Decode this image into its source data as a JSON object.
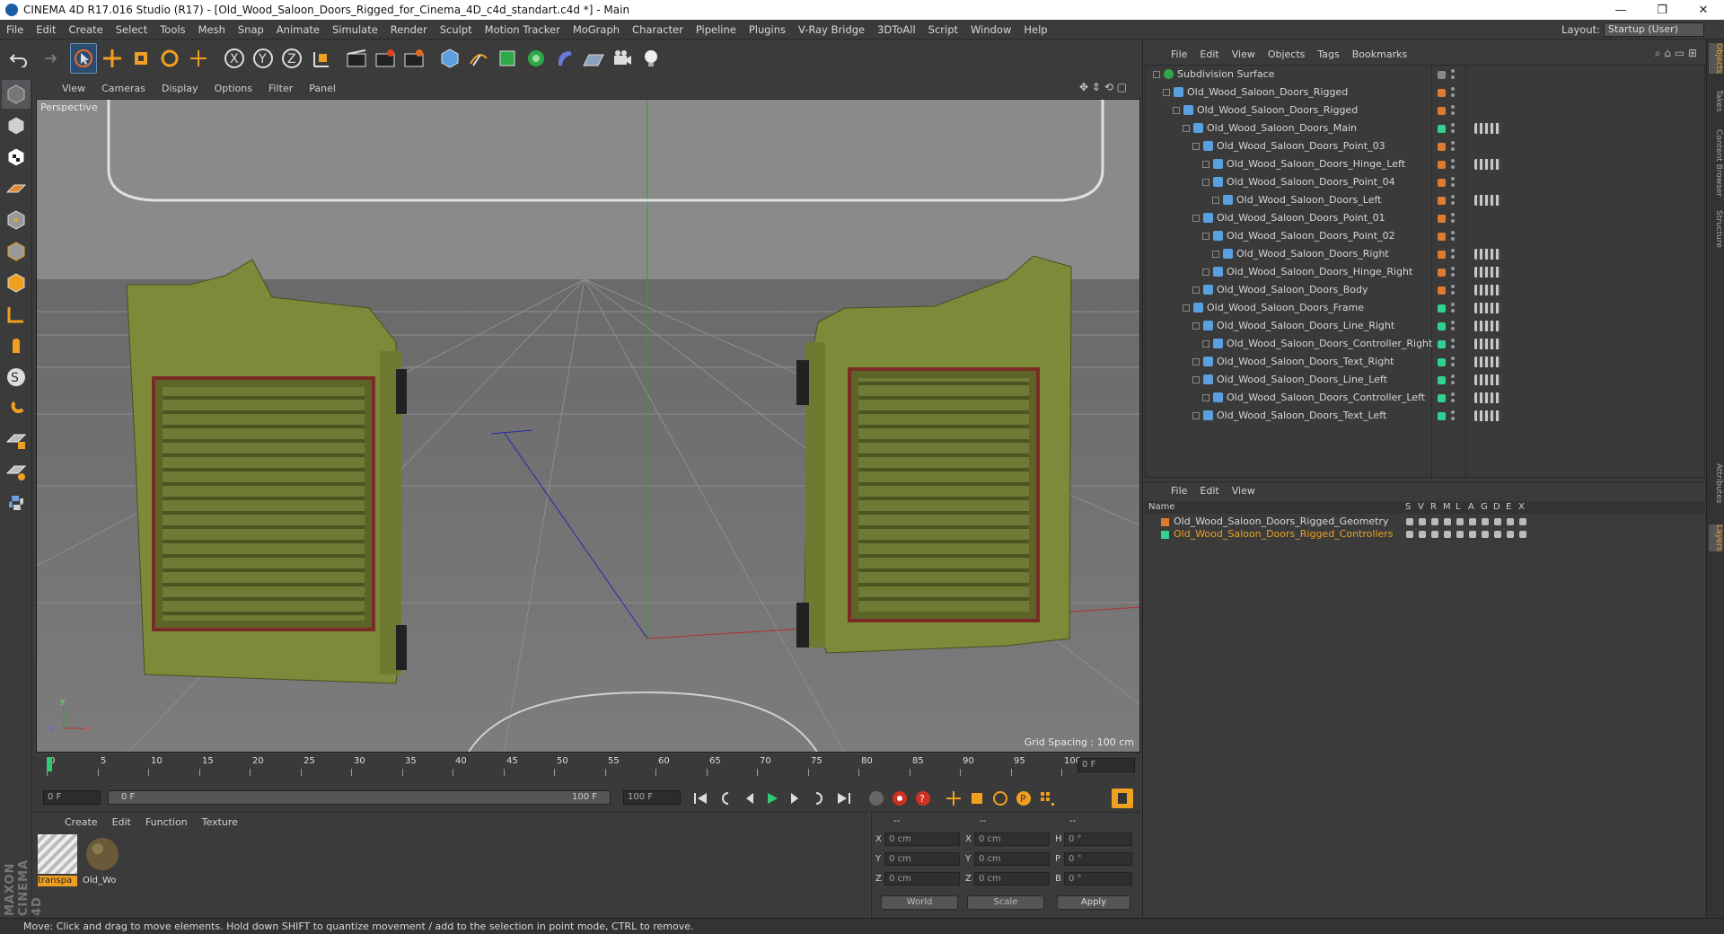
{
  "window": {
    "title": "CINEMA 4D R17.016 Studio (R17) - [Old_Wood_Saloon_Doors_Rigged_for_Cinema_4D_c4d_standart.c4d *] - Main",
    "controls": [
      "—",
      "❐",
      "✕"
    ]
  },
  "menubar": {
    "items": [
      "File",
      "Edit",
      "Create",
      "Select",
      "Tools",
      "Mesh",
      "Snap",
      "Animate",
      "Simulate",
      "Render",
      "Sculpt",
      "Motion Tracker",
      "MoGraph",
      "Character",
      "Pipeline",
      "Plugins",
      "V-Ray Bridge",
      "3DToAll",
      "Script",
      "Window",
      "Help"
    ],
    "layout_label": "Layout:",
    "layout_value": "Startup (User)"
  },
  "viewport": {
    "menu": [
      "View",
      "Cameras",
      "Display",
      "Options",
      "Filter",
      "Panel"
    ],
    "label": "Perspective",
    "grid_spacing": "Grid Spacing : 100 cm"
  },
  "timeline": {
    "ticks": [
      "0",
      "5",
      "10",
      "15",
      "20",
      "25",
      "30",
      "35",
      "40",
      "45",
      "50",
      "55",
      "60",
      "65",
      "70",
      "75",
      "80",
      "85",
      "90",
      "95",
      "100"
    ],
    "frame_field": "0 F",
    "start_field": "0 F",
    "range_start": "0 F",
    "range_end": "100 F",
    "end_field": "100 F"
  },
  "materials": {
    "menu": [
      "Create",
      "Edit",
      "Function",
      "Texture"
    ],
    "items": [
      {
        "label": "transpa",
        "selected": true
      },
      {
        "label": "Old_Wo",
        "selected": false
      }
    ]
  },
  "coords": {
    "headers": [
      "--",
      "--",
      "--"
    ],
    "rows": [
      {
        "a": "X",
        "av": "0 cm",
        "b": "X",
        "bv": "0 cm",
        "c": "H",
        "cv": "0 °"
      },
      {
        "a": "Y",
        "av": "0 cm",
        "b": "Y",
        "bv": "0 cm",
        "c": "P",
        "cv": "0 °"
      },
      {
        "a": "Z",
        "av": "0 cm",
        "b": "Z",
        "bv": "0 cm",
        "c": "B",
        "cv": "0 °"
      }
    ],
    "world": "World",
    "scale": "Scale",
    "apply": "Apply"
  },
  "status": "Move: Click and drag to move elements. Hold down SHIFT to quantize movement / add to the selection in point mode, CTRL to remove.",
  "objects": {
    "menu": [
      "File",
      "Edit",
      "View",
      "Objects",
      "Tags",
      "Bookmarks"
    ],
    "tree": [
      {
        "name": "Subdivision Surface",
        "depth": 0,
        "color": "#888888"
      },
      {
        "name": "Old_Wood_Saloon_Doors_Rigged",
        "depth": 1,
        "color": "#e07a2e"
      },
      {
        "name": "Old_Wood_Saloon_Doors_Rigged",
        "depth": 2,
        "color": "#e07a2e"
      },
      {
        "name": "Old_Wood_Saloon_Doors_Main",
        "depth": 3,
        "color": "#2fd28f"
      },
      {
        "name": "Old_Wood_Saloon_Doors_Point_03",
        "depth": 4,
        "color": "#e07a2e"
      },
      {
        "name": "Old_Wood_Saloon_Doors_Hinge_Left",
        "depth": 5,
        "color": "#e07a2e"
      },
      {
        "name": "Old_Wood_Saloon_Doors_Point_04",
        "depth": 5,
        "color": "#e07a2e"
      },
      {
        "name": "Old_Wood_Saloon_Doors_Left",
        "depth": 6,
        "color": "#e07a2e"
      },
      {
        "name": "Old_Wood_Saloon_Doors_Point_01",
        "depth": 4,
        "color": "#e07a2e"
      },
      {
        "name": "Old_Wood_Saloon_Doors_Point_02",
        "depth": 5,
        "color": "#e07a2e"
      },
      {
        "name": "Old_Wood_Saloon_Doors_Right",
        "depth": 6,
        "color": "#e07a2e"
      },
      {
        "name": "Old_Wood_Saloon_Doors_Hinge_Right",
        "depth": 5,
        "color": "#e07a2e"
      },
      {
        "name": "Old_Wood_Saloon_Doors_Body",
        "depth": 4,
        "color": "#e07a2e"
      },
      {
        "name": "Old_Wood_Saloon_Doors_Frame",
        "depth": 3,
        "color": "#2fd28f"
      },
      {
        "name": "Old_Wood_Saloon_Doors_Line_Right",
        "depth": 4,
        "color": "#2fd28f"
      },
      {
        "name": "Old_Wood_Saloon_Doors_Controller_Right",
        "depth": 5,
        "color": "#2fd28f"
      },
      {
        "name": "Old_Wood_Saloon_Doors_Text_Right",
        "depth": 4,
        "color": "#2fd28f"
      },
      {
        "name": "Old_Wood_Saloon_Doors_Line_Left",
        "depth": 4,
        "color": "#2fd28f"
      },
      {
        "name": "Old_Wood_Saloon_Doors_Controller_Left",
        "depth": 5,
        "color": "#2fd28f"
      },
      {
        "name": "Old_Wood_Saloon_Doors_Text_Left",
        "depth": 4,
        "color": "#2fd28f"
      }
    ]
  },
  "layers": {
    "menu": [
      "File",
      "Edit",
      "View"
    ],
    "header_name": "Name",
    "columns": [
      "S",
      "V",
      "R",
      "M",
      "L",
      "A",
      "G",
      "D",
      "E",
      "X"
    ],
    "rows": [
      {
        "name": "Old_Wood_Saloon_Doors_Rigged_Geometry",
        "color": "#e07a2e",
        "text_color": "#d8d8d8"
      },
      {
        "name": "Old_Wood_Saloon_Doors_Rigged_Controllers",
        "color": "#2fd28f",
        "text_color": "#f0a020"
      }
    ]
  },
  "side_tabs": [
    "Objects",
    "Takes",
    "Content Browser",
    "Structure",
    "Attributes",
    "Layers"
  ]
}
